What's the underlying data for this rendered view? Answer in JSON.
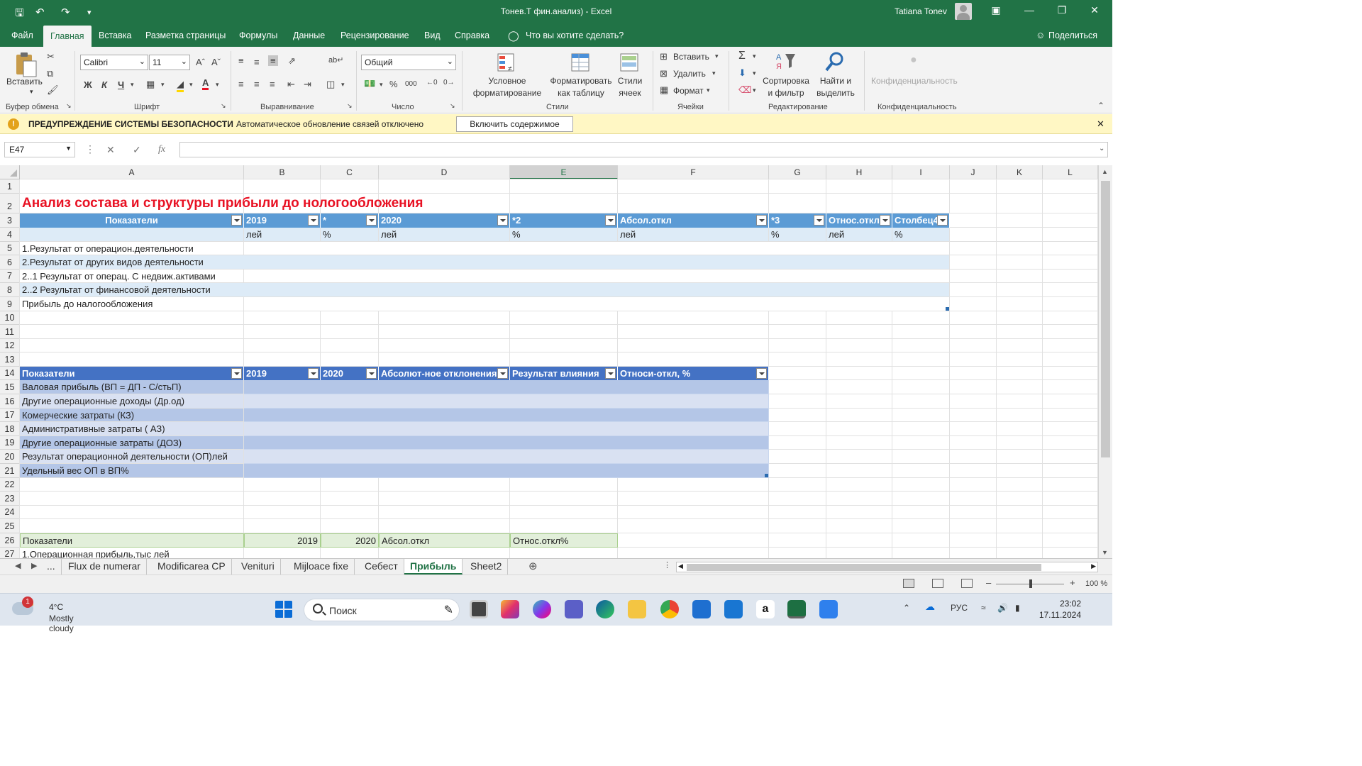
{
  "titlebar": {
    "doc_title": "Тонев.Т фин.анализ)  -  Excel",
    "user": "Tatiana Tonev"
  },
  "tabs": [
    {
      "label": "Файл"
    },
    {
      "label": "Главная"
    },
    {
      "label": "Вставка"
    },
    {
      "label": "Разметка страницы"
    },
    {
      "label": "Формулы"
    },
    {
      "label": "Данные"
    },
    {
      "label": "Рецензирование"
    },
    {
      "label": "Вид"
    },
    {
      "label": "Справка"
    },
    {
      "label": "Что вы хотите сделать?"
    }
  ],
  "share": "Поделиться",
  "ribbon": {
    "paste": "Вставить",
    "font_name": "Calibri",
    "font_size": "11",
    "bold": "Ж",
    "italic": "К",
    "underline": "Ч",
    "number_format": "Общий",
    "cond_format_1": "Условное",
    "cond_format_2": "форматирование",
    "format_table_1": "Форматировать",
    "format_table_2": "как таблицу",
    "cell_styles_1": "Стили",
    "cell_styles_2": "ячеек",
    "insert": "Вставить",
    "delete": "Удалить",
    "format": "Формат",
    "sort_1": "Сортировка",
    "sort_2": "и фильтр",
    "find_1": "Найти и",
    "find_2": "выделить",
    "confidential": "Конфиденциальность",
    "groups": {
      "clipboard": "Буфер обмена",
      "font": "Шрифт",
      "alignment": "Выравнивание",
      "number": "Число",
      "styles": "Стили",
      "cells": "Ячейки",
      "editing": "Редактирование",
      "confidential": "Конфиденциальность"
    }
  },
  "security": {
    "title": "ПРЕДУПРЕЖДЕНИЕ СИСТЕМЫ БЕЗОПАСНОСТИ",
    "message": "Автоматическое обновление связей отключено",
    "button": "Включить содержимое"
  },
  "formula_bar": {
    "name_box": "E47",
    "fx": "fx",
    "formula": ""
  },
  "columns": [
    "A",
    "B",
    "C",
    "D",
    "E",
    "F",
    "G",
    "H",
    "I",
    "J",
    "K",
    "L"
  ],
  "rows": [
    "1",
    "2",
    "3",
    "4",
    "5",
    "6",
    "7",
    "8",
    "9",
    "10",
    "11",
    "12",
    "13",
    "14",
    "15",
    "16",
    "17",
    "18",
    "19",
    "20",
    "21",
    "22",
    "23",
    "24",
    "25",
    "26",
    "27"
  ],
  "sheet": {
    "title": "Анализ состава и структуры прибыли до нологообложения",
    "table1": {
      "headers": [
        "Показатели",
        "2019",
        "*",
        "2020",
        "*2",
        "Абсол.откл",
        "*3",
        "Относ.откл",
        "Столбец4"
      ],
      "units": [
        "",
        "лей",
        "%",
        "лей",
        "%",
        "лей",
        "%",
        "лей",
        "%"
      ],
      "rows": [
        "1.Результат от операцион.деятельности",
        "2.Результат от других видов деятельности",
        "2..1 Результат от операц. С недвиж.активами",
        "2..2 Результат от финансовой деятельности",
        "Прибыль до налогообложения"
      ]
    },
    "table2": {
      "headers": [
        "Показатели",
        "2019",
        "2020",
        "Абсолют-ное отклонения",
        "Результат влияния",
        "Относи-откл, %"
      ],
      "rows": [
        "Валовая прибыль (ВП = ДП - С/стьП)",
        "Другие операционные доходы (Др.од)",
        "Комерческие затраты (КЗ)",
        "Административные затраты ( АЗ)",
        "Другие операционные затраты (ДОЗ)",
        "Результат операционной деятельности (ОП)лей",
        "Удельный вес  ОП в ВП%"
      ]
    },
    "table3": {
      "headers": [
        "Показатели",
        "2019",
        "2020",
        "Абсол.откл",
        "Относ.откл%"
      ],
      "first_row": "1.Операционная прибыль,тыс лей"
    }
  },
  "sheet_tabs": [
    "...",
    "Flux de numerar",
    "Modificarea CP",
    "Venituri",
    "Mijloace fixe",
    "Себест",
    "Прибыль",
    "Sheet2"
  ],
  "active_sheet": "Прибыль",
  "status": {
    "zoom": "100 %"
  },
  "taskbar": {
    "weather_badge": "1",
    "temperature": "4°C",
    "condition": "Mostly cloudy",
    "search_placeholder": "Поиск",
    "language": "РУС",
    "time": "23:02",
    "date": "17.11.2024"
  },
  "colors": {
    "excel_green": "#217346",
    "table1_header": "#5b9bd5",
    "table2_header": "#4472c4",
    "title_red": "#e81123",
    "security_bar": "#fff7c4"
  }
}
